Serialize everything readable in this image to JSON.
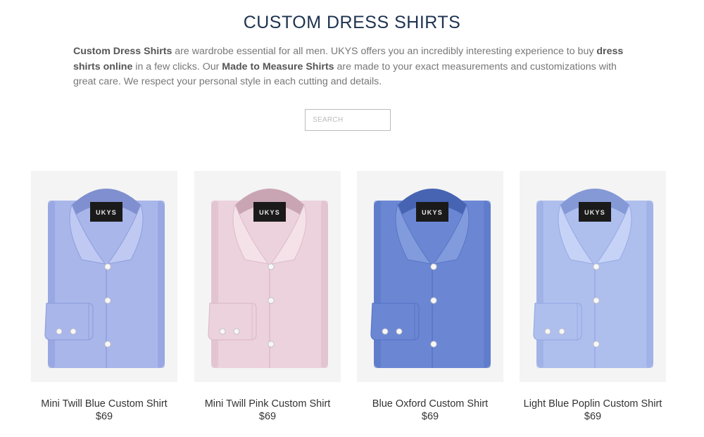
{
  "page": {
    "title": "CUSTOM DRESS SHIRTS"
  },
  "intro": {
    "segments": [
      {
        "text": "Custom Dress Shirts",
        "bold": true
      },
      {
        "text": " are wardrobe essential for all men. UKYS offers you an incredibly interesting experience to buy ",
        "bold": false
      },
      {
        "text": "dress shirts online",
        "bold": true
      },
      {
        "text": " in a few clicks. Our ",
        "bold": false
      },
      {
        "text": "Made to Measure Shirts",
        "bold": true
      },
      {
        "text": " are made to your exact measurements and customizations with great care. We respect your personal style in each cutting and details.",
        "bold": false
      }
    ]
  },
  "search": {
    "placeholder": "SEARCH",
    "value": ""
  },
  "products": [
    {
      "name": "Mini Twill Blue Custom Shirt",
      "price": "$69",
      "label_text": "UKYS",
      "colors": {
        "body": "#a9b6ea",
        "shade": "#8f9fdc",
        "light": "#bfc9f2",
        "dark": "#7f8fcf"
      }
    },
    {
      "name": "Mini Twill Pink Custom Shirt",
      "price": "$69",
      "label_text": "UKYS",
      "colors": {
        "body": "#ecd2dc",
        "shade": "#dcbcc9",
        "light": "#f5e2e9",
        "dark": "#c9a5b4"
      }
    },
    {
      "name": "Blue Oxford Custom Shirt",
      "price": "$69",
      "label_text": "UKYS",
      "colors": {
        "body": "#6b87d4",
        "shade": "#5876c6",
        "light": "#819bdc",
        "dark": "#4764b3"
      }
    },
    {
      "name": "Light Blue Poplin Custom Shirt",
      "price": "$69",
      "label_text": "UKYS",
      "colors": {
        "body": "#aebfee",
        "shade": "#97aae3",
        "light": "#c6d3f6",
        "dark": "#8599d6"
      }
    }
  ],
  "colors": {
    "title": "#1e3350",
    "text": "#777777",
    "label_bg": "#1a1a1a"
  }
}
